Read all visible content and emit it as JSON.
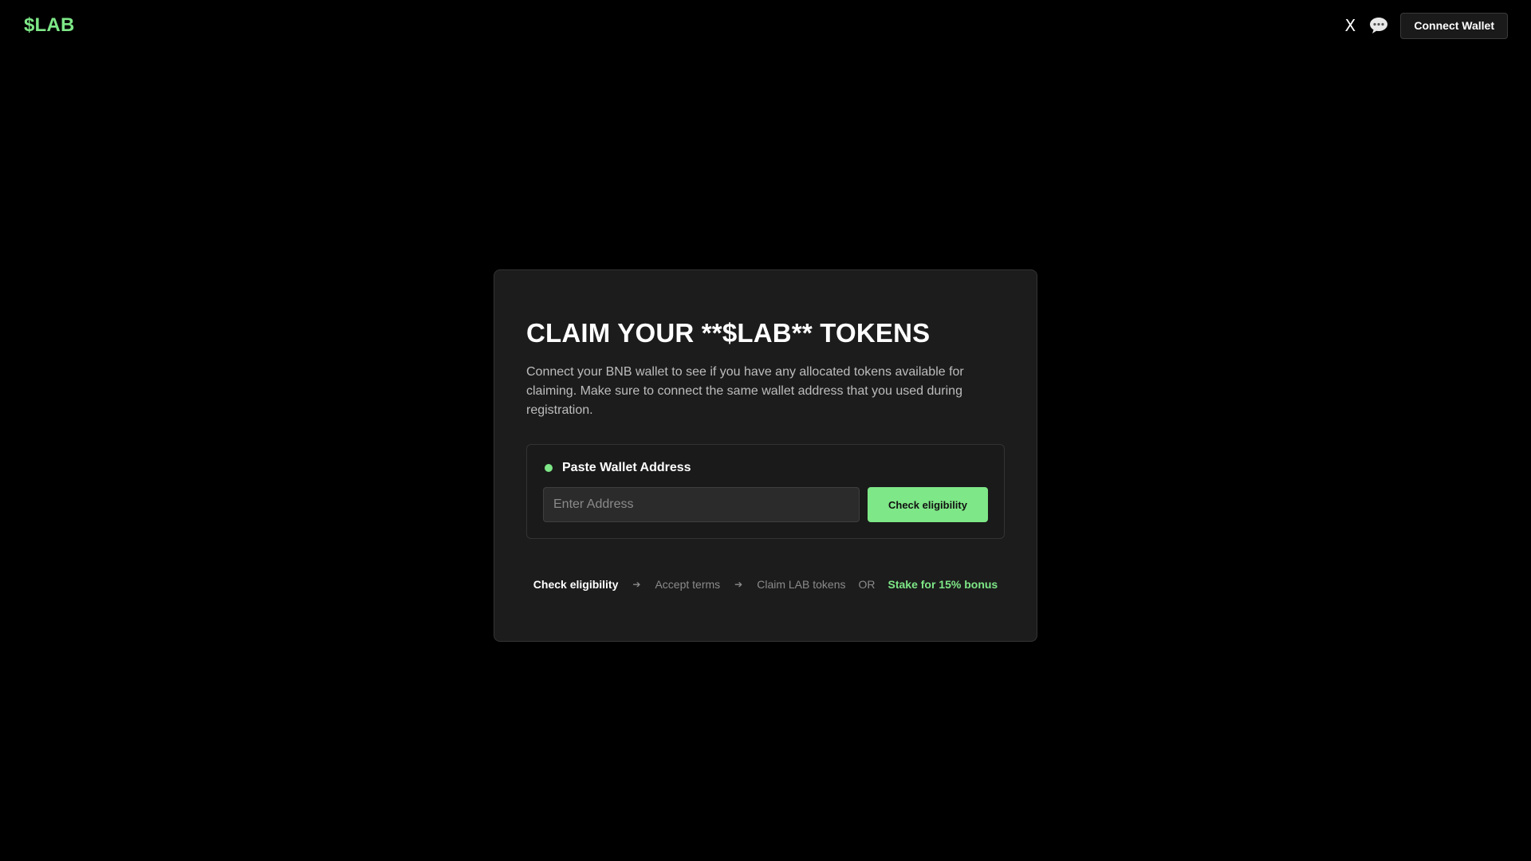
{
  "header": {
    "logo": "$LAB",
    "x_link": "X",
    "connect_wallet": "Connect Wallet"
  },
  "card": {
    "title": "CLAIM YOUR **$LAB** TOKENS",
    "description": "Connect your BNB wallet to see if you have any allocated tokens available for claiming. Make sure to connect the same wallet address that you used during registration.",
    "wallet": {
      "label": "Paste Wallet Address",
      "input_value": "",
      "input_placeholder": "Enter Address",
      "check_button": "Check eligibility"
    },
    "steps": {
      "step1": "Check eligibility",
      "step2": "Accept terms",
      "step3": "Claim LAB tokens",
      "or": "OR",
      "stake": "Stake for 15% bonus"
    }
  },
  "colors": {
    "accent": "#7ee787",
    "background": "#000000",
    "card": "#1c1c1c"
  },
  "icons": {
    "x": "x-logo-icon",
    "chat": "speech-bubble-icon",
    "arrow": "right-arrow-icon",
    "status": "status-dot-icon"
  }
}
